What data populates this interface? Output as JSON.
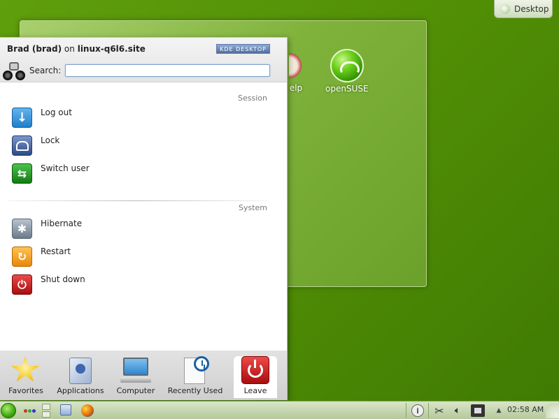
{
  "desktop": {
    "toolbox_label": "Desktop",
    "icons": [
      {
        "label": "elp"
      },
      {
        "label": "openSUSE"
      }
    ]
  },
  "menu": {
    "user_display": "Brad (brad)",
    "on_text": "on",
    "hostname": "linux-q6l6.site",
    "kde_badge": "KDE DESKTOP",
    "search_label": "Search:",
    "search_value": "",
    "sections": {
      "session": {
        "title": "Session",
        "items": [
          {
            "label": "Log out",
            "icon": "logout-icon"
          },
          {
            "label": "Lock",
            "icon": "lock-icon"
          },
          {
            "label": "Switch user",
            "icon": "switch-user-icon"
          }
        ]
      },
      "system": {
        "title": "System",
        "items": [
          {
            "label": "Hibernate",
            "icon": "hibernate-icon"
          },
          {
            "label": "Restart",
            "icon": "restart-icon"
          },
          {
            "label": "Shut down",
            "icon": "shutdown-icon"
          }
        ]
      }
    },
    "tabs": [
      {
        "label": "Favorites",
        "icon": "star-icon"
      },
      {
        "label": "Applications",
        "icon": "applications-icon"
      },
      {
        "label": "Computer",
        "icon": "computer-icon"
      },
      {
        "label": "Recently Used",
        "icon": "recently-used-icon"
      },
      {
        "label": "Leave",
        "icon": "leave-icon",
        "active": true
      }
    ]
  },
  "panel": {
    "clock": "02:58 AM"
  },
  "colors": {
    "desktop_bg": "#5f9e0c",
    "panel_bg": "#c7d8b2",
    "accent_blue": "#1f7fc9"
  }
}
